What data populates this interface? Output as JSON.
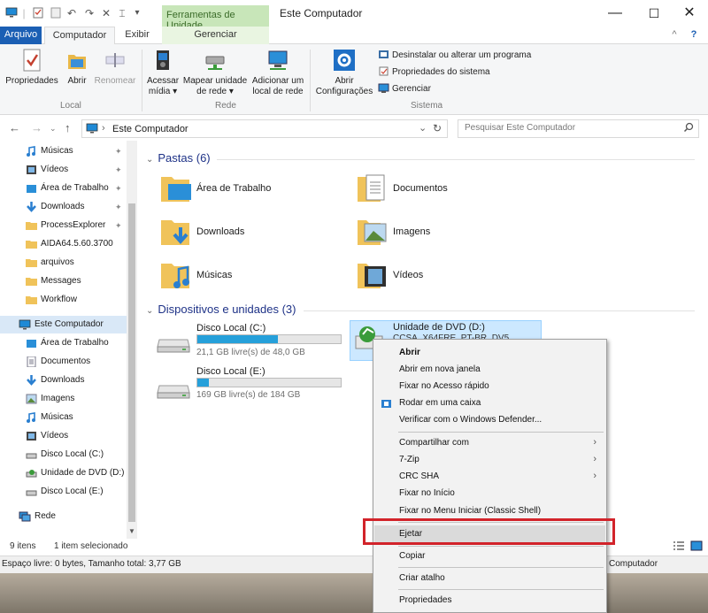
{
  "window": {
    "title": "Este Computador",
    "contextual_tab_header": "Ferramentas de Unidade",
    "controls": {
      "minimize": "—",
      "maximize": "☐",
      "close": "✕"
    },
    "qat": {
      "dropdown": "▾"
    }
  },
  "tabs": {
    "file": "Arquivo",
    "computer": "Computador",
    "view": "Exibir",
    "manage": "Gerenciar",
    "help": "?"
  },
  "ribbon": {
    "properties": "Propriedades",
    "open": "Abrir",
    "rename": "Renomear",
    "group_local": "Local",
    "access_media_1": "Acessar",
    "access_media_2": "mídia ▾",
    "map_drive_1": "Mapear unidade",
    "map_drive_2": "de rede ▾",
    "add_location_1": "Adicionar um",
    "add_location_2": "local de rede",
    "group_network": "Rede",
    "open_settings_1": "Abrir",
    "open_settings_2": "Configurações",
    "uninstall": "Desinstalar ou alterar um programa",
    "system_props": "Propriedades do sistema",
    "manage": "Gerenciar",
    "group_system": "Sistema"
  },
  "address": {
    "back": "←",
    "forward": "→",
    "up": "↑",
    "path": "Este Computador",
    "separator": "›",
    "dropdown": "⌄",
    "refresh": "↻",
    "search_placeholder": "Pesquisar Este Computador"
  },
  "nav": {
    "quick_access": [
      {
        "label": "Músicas",
        "icon": "music-icon",
        "pinned": true
      },
      {
        "label": "Vídeos",
        "icon": "video-icon",
        "pinned": true
      },
      {
        "label": "Área de Trabalho",
        "icon": "desktop-icon",
        "pinned": true
      },
      {
        "label": "Downloads",
        "icon": "download-icon",
        "pinned": true
      },
      {
        "label": "ProcessExplorer",
        "icon": "folder-icon",
        "pinned": true
      },
      {
        "label": "AIDA64.5.60.3700",
        "icon": "folder-icon",
        "pinned": false
      },
      {
        "label": "arquivos",
        "icon": "folder-icon",
        "pinned": false
      },
      {
        "label": "Messages",
        "icon": "folder-icon",
        "pinned": false
      },
      {
        "label": "Workflow",
        "icon": "folder-icon",
        "pinned": false
      }
    ],
    "this_pc": "Este Computador",
    "this_pc_items": [
      {
        "label": "Área de Trabalho",
        "icon": "desktop-icon"
      },
      {
        "label": "Documentos",
        "icon": "document-icon"
      },
      {
        "label": "Downloads",
        "icon": "download-icon"
      },
      {
        "label": "Imagens",
        "icon": "image-icon"
      },
      {
        "label": "Músicas",
        "icon": "music-icon"
      },
      {
        "label": "Vídeos",
        "icon": "video-icon"
      },
      {
        "label": "Disco Local (C:)",
        "icon": "drive-icon"
      },
      {
        "label": "Unidade de DVD (D:)",
        "icon": "dvd-icon"
      },
      {
        "label": "Disco Local (E:)",
        "icon": "drive-icon"
      }
    ],
    "network": "Rede",
    "pin_glyph": "📌"
  },
  "content": {
    "folders_header": "Pastas (6)",
    "folders": [
      {
        "label": "Área de Trabalho",
        "icon": "desktop-folder-icon"
      },
      {
        "label": "Documentos",
        "icon": "documents-folder-icon"
      },
      {
        "label": "Downloads",
        "icon": "downloads-folder-icon"
      },
      {
        "label": "Imagens",
        "icon": "pictures-folder-icon"
      },
      {
        "label": "Músicas",
        "icon": "music-folder-icon"
      },
      {
        "label": "Vídeos",
        "icon": "videos-folder-icon"
      }
    ],
    "devices_header": "Dispositivos e unidades (3)",
    "drives": [
      {
        "name": "Disco Local (C:)",
        "free": "21,1 GB livre(s) de 48,0 GB",
        "used_fraction": 0.56
      },
      {
        "name": "Disco Local (E:)",
        "free": "169 GB livre(s) de 184 GB",
        "used_fraction": 0.08
      }
    ],
    "dvd": {
      "name": "Unidade de DVD (D:)",
      "label": "CCSA_X64FRE_PT-BR_DV5"
    }
  },
  "status": {
    "items": "9 itens",
    "selected": "1 item selecionado",
    "bottom": "Espaço livre: 0 bytes, Tamanho total: 3,77 GB",
    "bottom_right": "Computador"
  },
  "menu": {
    "open": "Abrir",
    "open_new_window": "Abrir em nova janela",
    "pin_quick_access": "Fixar no Acesso rápido",
    "run_box": "Rodar em uma caixa",
    "defender": "Verificar com o Windows Defender...",
    "share_with": "Compartilhar com",
    "zip": "7-Zip",
    "crc": "CRC SHA",
    "pin_start": "Fixar no Início",
    "pin_classic": "Fixar no Menu Iniciar (Classic Shell)",
    "eject": "Ejetar",
    "copy": "Copiar",
    "create_shortcut": "Criar atalho",
    "properties": "Propriedades",
    "submenu_arrow": "›"
  },
  "colors": {
    "accent": "#1b5fb4",
    "context_tab": "#c8e6b9",
    "selection": "#cce8ff",
    "highlight_box": "#d2232a",
    "progress": "#26a0da"
  }
}
